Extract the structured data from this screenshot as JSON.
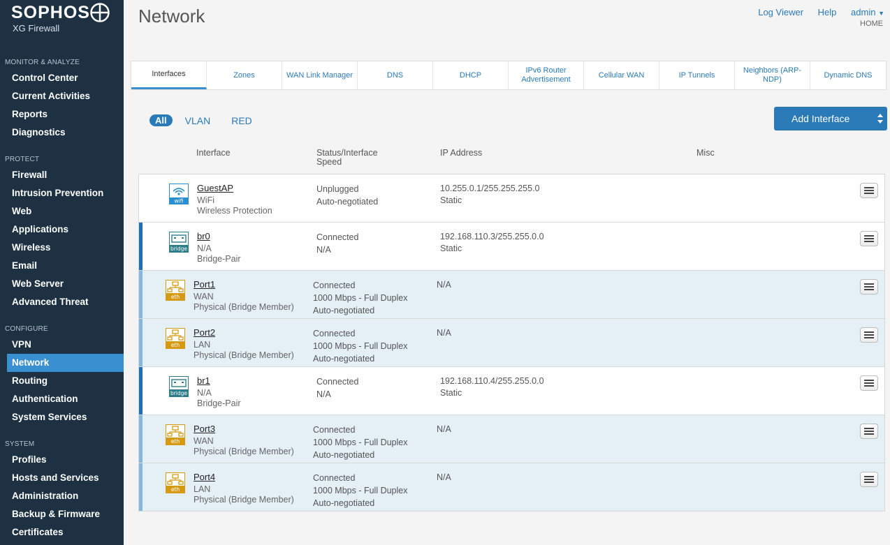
{
  "brand": {
    "name": "SOPHOS",
    "product": "XG Firewall"
  },
  "sidebar": {
    "sections": [
      {
        "heading": "MONITOR & ANALYZE",
        "items": [
          "Control Center",
          "Current Activities",
          "Reports",
          "Diagnostics"
        ]
      },
      {
        "heading": "PROTECT",
        "items": [
          "Firewall",
          "Intrusion Prevention",
          "Web",
          "Applications",
          "Wireless",
          "Email",
          "Web Server",
          "Advanced Threat"
        ]
      },
      {
        "heading": "CONFIGURE",
        "items": [
          "VPN",
          "Network",
          "Routing",
          "Authentication",
          "System Services"
        ]
      },
      {
        "heading": "SYSTEM",
        "items": [
          "Profiles",
          "Hosts and Services",
          "Administration",
          "Backup & Firmware",
          "Certificates"
        ]
      }
    ],
    "active_item": "Network"
  },
  "header": {
    "title": "Network",
    "links": [
      "Log Viewer",
      "Help",
      "admin"
    ],
    "home": "HOME"
  },
  "tabs": [
    {
      "label": "Interfaces",
      "active": true
    },
    {
      "label": "Zones"
    },
    {
      "label": "WAN Link Manager"
    },
    {
      "label": "DNS"
    },
    {
      "label": "DHCP"
    },
    {
      "label": "IPv6 Router Advertisement"
    },
    {
      "label": "Cellular WAN"
    },
    {
      "label": "IP Tunnels"
    },
    {
      "label": "Neighbors (ARP-NDP)"
    },
    {
      "label": "Dynamic DNS"
    }
  ],
  "filters": {
    "all": "All",
    "vlan": "VLAN",
    "red": "RED"
  },
  "add_button": "Add Interface",
  "table": {
    "headers": {
      "interface": "Interface",
      "status": "Status/Interface Speed",
      "ip": "IP Address",
      "misc": "Misc"
    },
    "rows": [
      {
        "kind": "wifi",
        "icon_label": "wifi",
        "name": "GuestAP",
        "zone": "WiFi",
        "type": "Wireless Protection",
        "status": [
          "Unplugged",
          "Auto-negotiated"
        ],
        "ip": [
          "10.255.0.1/255.255.255.0",
          "Static"
        ]
      },
      {
        "kind": "bridge",
        "icon_label": "bridge",
        "name": "br0",
        "zone": "N/A",
        "type": "Bridge-Pair",
        "status": [
          "Connected",
          "N/A"
        ],
        "ip": [
          "192.168.110.3/255.255.0.0",
          "Static"
        ]
      },
      {
        "kind": "member",
        "icon_label": "eth",
        "name": "Port1",
        "zone": "WAN",
        "type": "Physical (Bridge Member)",
        "status": [
          "Connected",
          "1000 Mbps - Full Duplex",
          "Auto-negotiated"
        ],
        "ip": [
          "N/A"
        ]
      },
      {
        "kind": "member",
        "icon_label": "eth",
        "name": "Port2",
        "zone": "LAN",
        "type": "Physical (Bridge Member)",
        "status": [
          "Connected",
          "1000 Mbps - Full Duplex",
          "Auto-negotiated"
        ],
        "ip": [
          "N/A"
        ]
      },
      {
        "kind": "bridge",
        "icon_label": "bridge",
        "name": "br1",
        "zone": "N/A",
        "type": "Bridge-Pair",
        "status": [
          "Connected",
          "N/A"
        ],
        "ip": [
          "192.168.110.4/255.255.0.0",
          "Static"
        ]
      },
      {
        "kind": "member",
        "icon_label": "eth",
        "name": "Port3",
        "zone": "WAN",
        "type": "Physical (Bridge Member)",
        "status": [
          "Connected",
          "1000 Mbps - Full Duplex",
          "Auto-negotiated"
        ],
        "ip": [
          "N/A"
        ]
      },
      {
        "kind": "member",
        "icon_label": "eth",
        "name": "Port4",
        "zone": "LAN",
        "type": "Physical (Bridge Member)",
        "status": [
          "Connected",
          "1000 Mbps - Full Duplex",
          "Auto-negotiated"
        ],
        "ip": [
          "N/A"
        ]
      }
    ]
  },
  "colors": {
    "sidebar_bg": "#1d3143",
    "accent": "#2a7ab8",
    "active_nav": "#3a8fd0",
    "eth_icon": "#d69a12",
    "bridge_icon": "#2e7d8a",
    "wifi_icon": "#2a8fd0"
  }
}
